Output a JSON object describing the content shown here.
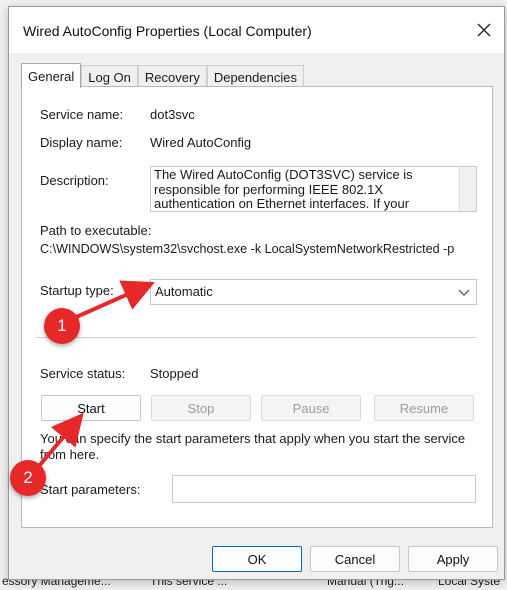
{
  "background": {
    "row_text": [
      "essory Manageme...",
      "This service ...",
      "Manual (Trig...",
      "Local Syste"
    ]
  },
  "dialog": {
    "title": "Wired AutoConfig Properties (Local Computer)",
    "close_icon": "close-icon"
  },
  "tabs": [
    {
      "label": "General",
      "active": true
    },
    {
      "label": "Log On",
      "active": false
    },
    {
      "label": "Recovery",
      "active": false
    },
    {
      "label": "Dependencies",
      "active": false
    }
  ],
  "general": {
    "service_name_label": "Service name:",
    "service_name": "dot3svc",
    "display_name_label": "Display name:",
    "display_name": "Wired AutoConfig",
    "description_label": "Description:",
    "description": "The Wired AutoConfig (DOT3SVC) service is responsible for performing IEEE 802.1X authentication on Ethernet interfaces. If your current",
    "path_label": "Path to executable:",
    "path": "C:\\WINDOWS\\system32\\svchost.exe -k LocalSystemNetworkRestricted -p",
    "startup_type_label": "Startup type:",
    "startup_type": "Automatic",
    "service_status_label": "Service status:",
    "service_status": "Stopped",
    "start_label": "Start",
    "stop_label": "Stop",
    "pause_label": "Pause",
    "resume_label": "Resume",
    "hint_text": "You can specify the start parameters that apply when you start the service from here.",
    "start_params_label": "Start parameters:",
    "start_params_value": ""
  },
  "footer": {
    "ok_label": "OK",
    "cancel_label": "Cancel",
    "apply_label": "Apply"
  },
  "annotations": [
    {
      "label": "1",
      "color": "#e62828"
    },
    {
      "label": "2",
      "color": "#e62828"
    }
  ]
}
